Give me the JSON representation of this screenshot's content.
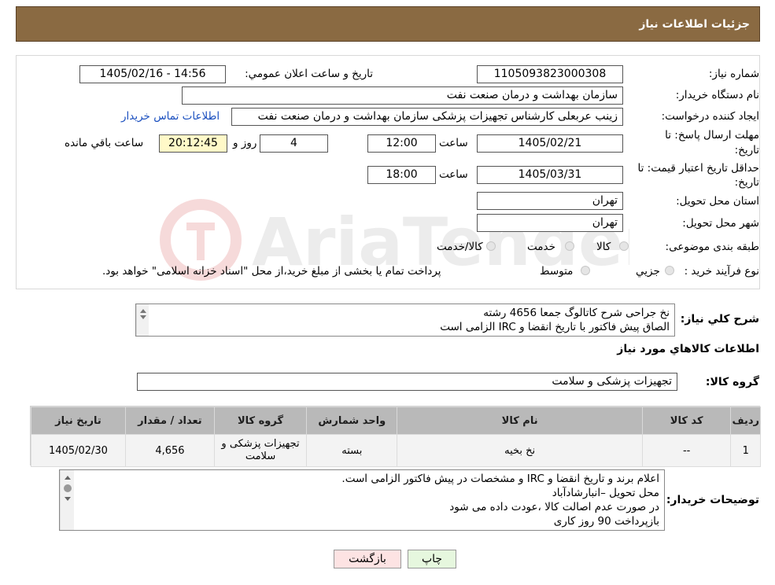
{
  "header": {
    "title": "جزئیات اطلاعات نیاز"
  },
  "form": {
    "need_number_label": "شماره نیاز:",
    "need_number": "1105093823000308",
    "announce_label": "تاریخ و ساعت اعلان عمومي:",
    "announce_value": "1405/02/16 - 14:56",
    "buyer_org_label": "نام دستگاه خريدار:",
    "buyer_org": "سازمان بهداشت و درمان صنعت نفت",
    "creator_label": "ايجاد كننده درخواست:",
    "creator": "زینب عربعلی کارشناس تجهیزات پزشکی سازمان بهداشت و درمان صنعت نفت",
    "contact_link": "اطلاعات تماس خريدار",
    "deadline_label_1": "مهلت ارسال پاسخ: تا",
    "deadline_label_2": "تاريخ:",
    "deadline_date": "1405/02/21",
    "time_label": "ساعت",
    "deadline_time": "12:00",
    "days_value": "4",
    "days_label": "روز و",
    "remaining_time": "20:12:45",
    "remaining_label": "ساعت باقي مانده",
    "validity_label_1": "حداقل تاريخ اعتبار قيمت: تا",
    "validity_label_2": "تاريخ:",
    "validity_date": "1405/03/31",
    "validity_time_label": "ساعت",
    "validity_time": "18:00",
    "province_label": "استان محل تحويل:",
    "province": "تهران",
    "city_label": "شهر محل تحويل:",
    "city": "تهران",
    "category_label": "طبقه بندی موضوعی:",
    "category_options": [
      "کالا",
      "خدمت",
      "کالا/خدمت"
    ],
    "process_label": "نوع فرآيند خريد :",
    "process_options": [
      "جزيي",
      "متوسط"
    ],
    "process_note": "پرداخت تمام يا بخشی از مبلغ خريد،از محل \"اسناد خزانه اسلامی\" خواهد بود."
  },
  "description": {
    "label": "شرح کلي نياز:",
    "lines": [
      "نخ جراحی  شرح کاتالوگ جمعا 4656 رشته",
      "الصاق پیش فاکتور با تاریخ انقضا و IRC  الزامی است"
    ]
  },
  "goods": {
    "section_title": "اطلاعات کالاهاي مورد نياز",
    "group_label": "گروه کالا:",
    "group_value": "تجهیزات پزشکی و سلامت",
    "columns": [
      "رديف",
      "کد کالا",
      "نام کالا",
      "واحد شمارش",
      "گروه کالا",
      "تعداد / مقدار",
      "تاريخ نياز"
    ],
    "rows": [
      {
        "index": "1",
        "code": "--",
        "name": "نخ بخیه",
        "unit": "بسته",
        "group_line1": "تجهیزات پزشکی و",
        "group_line2": "سلامت",
        "qty": "4,656",
        "date": "1405/02/30"
      }
    ]
  },
  "buyer_notes": {
    "label": "توضيحات خريدار:",
    "lines": [
      "اعلام برند و تاریخ انقضا  و IRC  و مشخصات  در پیش فاکتور الزامی است.",
      "محل تحویل –انبارشادآباد",
      "در صورت عدم اصالت کالا ،عودت داده می شود",
      "بازپرداخت 90 روز کاری"
    ]
  },
  "buttons": {
    "print": "چاپ",
    "back": "بازگشت"
  },
  "watermark": {
    "text": "AriaTender.neT"
  },
  "colors": {
    "header_bg": "#8a6a42",
    "link": "#1a4fbf",
    "remaining_bg": "#fff9c8",
    "back_btn_bg": "#fde3e3",
    "print_btn_bg": "#e6f7de"
  }
}
